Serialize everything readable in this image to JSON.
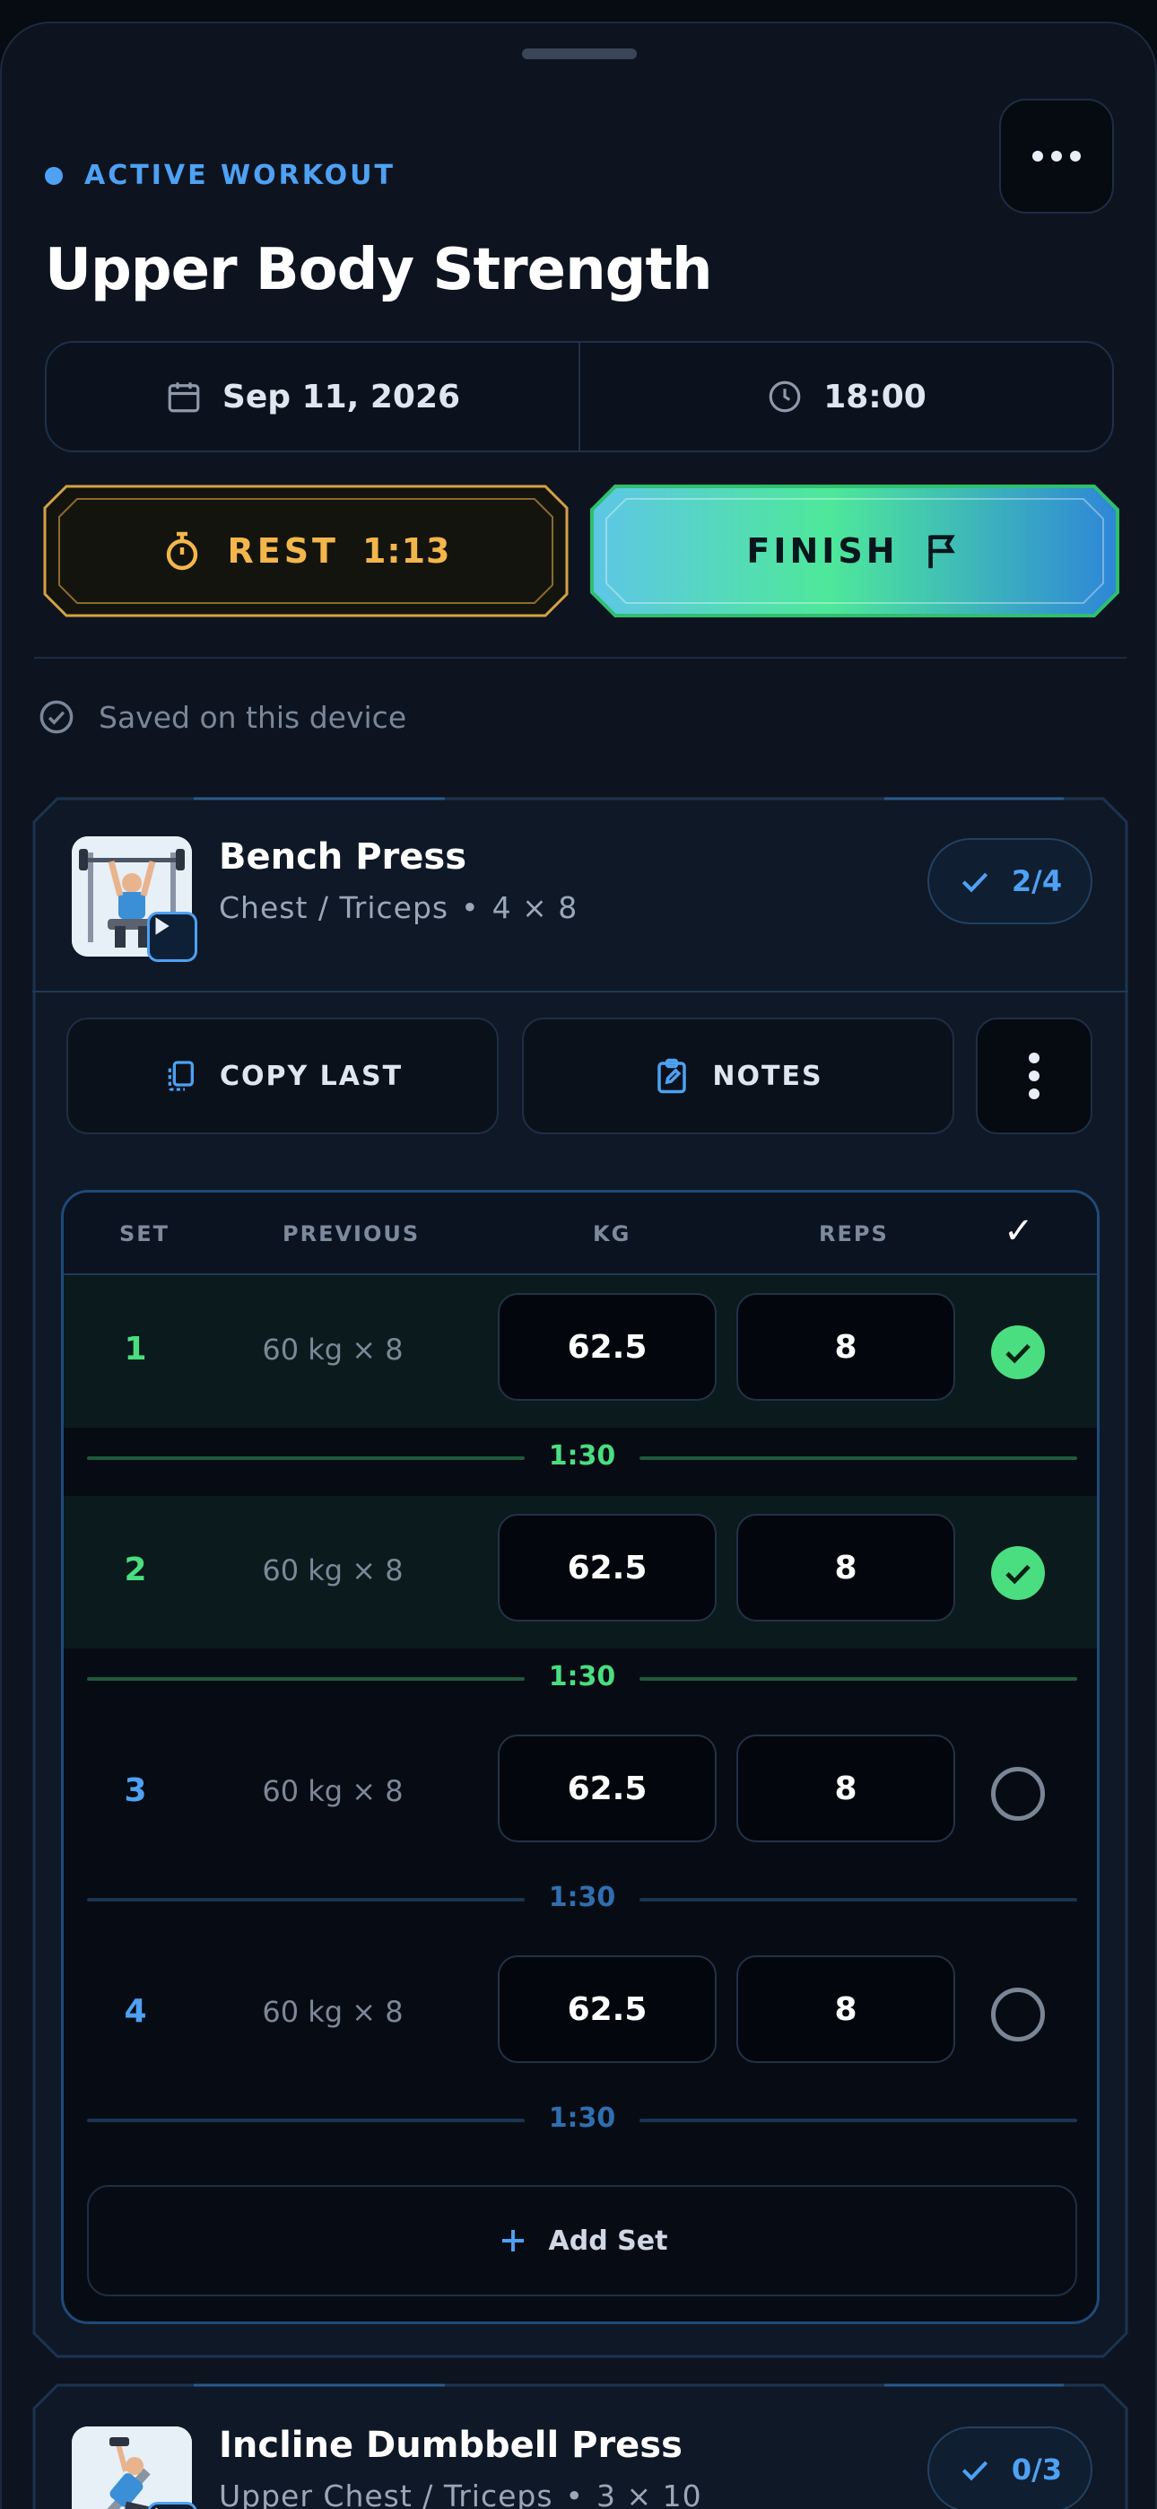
{
  "header": {
    "status_label": "ACTIVE WORKOUT",
    "title": "Upper Body Strength",
    "date": "Sep 11, 2026",
    "time": "18:00"
  },
  "actions": {
    "rest_label": "REST",
    "rest_time": "1:13",
    "finish_label": "FINISH"
  },
  "saved_text": "Saved on this device",
  "exercises": [
    {
      "name": "Bench Press",
      "muscles": "Chest / Triceps",
      "scheme": "4 × 8",
      "progress": "2/4",
      "tools": {
        "copy_last": "COPY LAST",
        "notes": "NOTES"
      },
      "table_headers": {
        "set": "SET",
        "previous": "PREVIOUS",
        "kg": "KG",
        "reps": "REPS",
        "done": "✓"
      },
      "sets": [
        {
          "set": "1",
          "previous": "60 kg × 8",
          "kg": "62.5",
          "reps": "8",
          "done": true,
          "rest": "1:30"
        },
        {
          "set": "2",
          "previous": "60 kg × 8",
          "kg": "62.5",
          "reps": "8",
          "done": true,
          "rest": "1:30"
        },
        {
          "set": "3",
          "previous": "60 kg × 8",
          "kg": "62.5",
          "reps": "8",
          "done": false,
          "rest": "1:30"
        },
        {
          "set": "4",
          "previous": "60 kg × 8",
          "kg": "62.5",
          "reps": "8",
          "done": false,
          "rest": "1:30"
        }
      ],
      "add_set_label": "Add Set"
    },
    {
      "name": "Incline Dumbbell Press",
      "muscles": "Upper Chest / Triceps",
      "scheme": "3 × 10",
      "progress": "0/3"
    }
  ],
  "separator": "•",
  "icons": [
    "more-icon",
    "calendar-icon",
    "clock-icon",
    "stopwatch-icon",
    "flag-icon",
    "check-circle-icon",
    "play-icon",
    "check-icon",
    "copy-icon",
    "clipboard-edit-icon",
    "kebab-icon",
    "plus-icon"
  ],
  "colors": {
    "accent_blue": "#4ea1f3",
    "rest_amber": "#f3b64a",
    "done_green": "#4ade80",
    "background": "#0d1420"
  }
}
